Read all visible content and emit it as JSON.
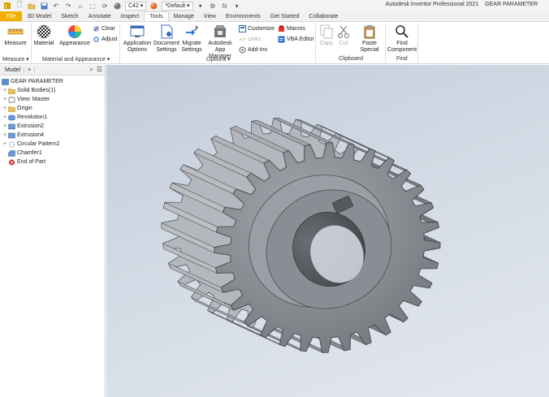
{
  "window": {
    "app_title": "Autodesk Inventor Professional 2021",
    "document_title": "GEAR PARAMETER"
  },
  "quick_access": {
    "material_value": "C42",
    "appearance_value": "*Default"
  },
  "menu_tabs": [
    "File",
    "3D Model",
    "Sketch",
    "Annotate",
    "Inspect",
    "Tools",
    "Manage",
    "View",
    "Environments",
    "Get Started",
    "Collaborate"
  ],
  "active_tab": "Tools",
  "ribbon": {
    "measure_label": "Measure",
    "material_label": "Material",
    "appearance_label": "Appearance",
    "clear_label": "Clear",
    "adjust_label": "Adjust",
    "application_options_label": "Application Options",
    "document_settings_label": "Document Settings",
    "migrate_settings_label": "Migrate Settings",
    "app_manager_label": "Autodesk App Manager",
    "customize_label": "Customize",
    "links_label": "Links",
    "addins_label": "Add-Ins",
    "macros_label": "Macros",
    "vba_editor_label": "VBA Editor",
    "copy_label": "Copy",
    "cut_label": "Cut",
    "paste_special_label": "Paste Special",
    "find_component_label": "Find Component",
    "panel_measure": "Measure",
    "panel_material_appearance": "Material and Appearance",
    "panel_options": "Options",
    "panel_clipboard": "Clipboard",
    "panel_find": "Find"
  },
  "browser": {
    "tab_label": "Model",
    "add_tab": "+",
    "root_label": "GEAR PARAMETER",
    "items": [
      {
        "label": "Solid Bodies(1)",
        "expand": "+"
      },
      {
        "label": "View: Master",
        "expand": "+"
      },
      {
        "label": "Origin",
        "expand": "+"
      },
      {
        "label": "Revolution1",
        "expand": "+"
      },
      {
        "label": "Extrusion2",
        "expand": "+"
      },
      {
        "label": "Extrusion4",
        "expand": "+"
      },
      {
        "label": "Circular Pattern2",
        "expand": "+"
      },
      {
        "label": "Chamfer1",
        "expand": ""
      },
      {
        "label": "End of Part",
        "expand": ""
      }
    ]
  },
  "colors": {
    "file_tab": "#f0b000",
    "viewport_top": "#c2ccda",
    "viewport_bottom": "#e4e8ee",
    "gear_body": "#8f9298"
  },
  "model": {
    "gear_teeth_count": 32
  }
}
